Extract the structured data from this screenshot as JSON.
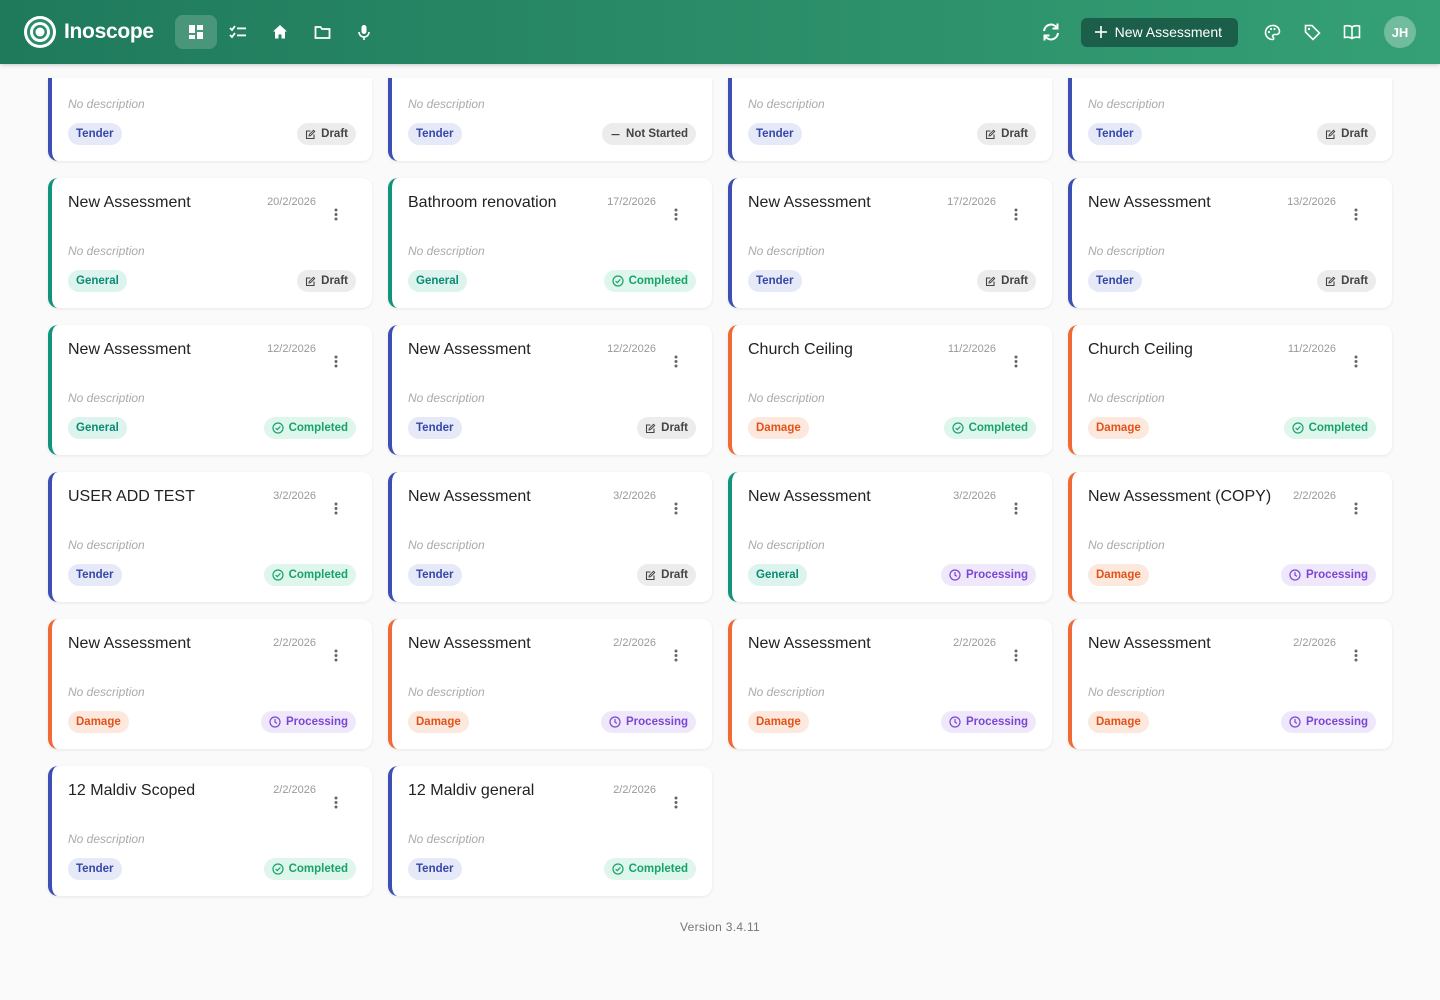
{
  "app": {
    "name": "Inoscope",
    "new_button_label": "New Assessment",
    "avatar_initials": "JH"
  },
  "nav": [
    {
      "icon": "dashboard-icon",
      "active": true
    },
    {
      "icon": "checklist-icon",
      "active": false
    },
    {
      "icon": "home-icon",
      "active": false
    },
    {
      "icon": "folder-icon",
      "active": false
    },
    {
      "icon": "microphone-icon",
      "active": false
    }
  ],
  "colors": {
    "tender": "#3d4fb4",
    "general": "#11937c",
    "damage": "#f06a35",
    "header": "#2a8c68"
  },
  "cards": [
    {
      "title": "",
      "date": "",
      "description": "No description",
      "type": "Tender",
      "status": "Draft"
    },
    {
      "title": "",
      "date": "",
      "description": "No description",
      "type": "Tender",
      "status": "Not Started"
    },
    {
      "title": "",
      "date": "",
      "description": "No description",
      "type": "Tender",
      "status": "Draft"
    },
    {
      "title": "",
      "date": "",
      "description": "No description",
      "type": "Tender",
      "status": "Draft"
    },
    {
      "title": "New Assessment",
      "date": "20/2/2026",
      "description": "No description",
      "type": "General",
      "status": "Draft"
    },
    {
      "title": "Bathroom renovation",
      "date": "17/2/2026",
      "description": "No description",
      "type": "General",
      "status": "Completed"
    },
    {
      "title": "New Assessment",
      "date": "17/2/2026",
      "description": "No description",
      "type": "Tender",
      "status": "Draft"
    },
    {
      "title": "New Assessment",
      "date": "13/2/2026",
      "description": "No description",
      "type": "Tender",
      "status": "Draft"
    },
    {
      "title": "New Assessment",
      "date": "12/2/2026",
      "description": "No description",
      "type": "General",
      "status": "Completed"
    },
    {
      "title": "New Assessment",
      "date": "12/2/2026",
      "description": "No description",
      "type": "Tender",
      "status": "Draft"
    },
    {
      "title": "Church Ceiling",
      "date": "11/2/2026",
      "description": "No description",
      "type": "Damage",
      "status": "Completed"
    },
    {
      "title": "Church Ceiling",
      "date": "11/2/2026",
      "description": "No description",
      "type": "Damage",
      "status": "Completed"
    },
    {
      "title": "USER ADD TEST",
      "date": "3/2/2026",
      "description": "No description",
      "type": "Tender",
      "status": "Completed"
    },
    {
      "title": "New Assessment",
      "date": "3/2/2026",
      "description": "No description",
      "type": "Tender",
      "status": "Draft"
    },
    {
      "title": "New Assessment",
      "date": "3/2/2026",
      "description": "No description",
      "type": "General",
      "status": "Processing"
    },
    {
      "title": "New Assessment (COPY)",
      "date": "2/2/2026",
      "description": "No description",
      "type": "Damage",
      "status": "Processing"
    },
    {
      "title": "New Assessment",
      "date": "2/2/2026",
      "description": "No description",
      "type": "Damage",
      "status": "Processing"
    },
    {
      "title": "New Assessment",
      "date": "2/2/2026",
      "description": "No description",
      "type": "Damage",
      "status": "Processing"
    },
    {
      "title": "New Assessment",
      "date": "2/2/2026",
      "description": "No description",
      "type": "Damage",
      "status": "Processing"
    },
    {
      "title": "New Assessment",
      "date": "2/2/2026",
      "description": "No description",
      "type": "Damage",
      "status": "Processing"
    },
    {
      "title": "12 Maldiv Scoped",
      "date": "2/2/2026",
      "description": "No description",
      "type": "Tender",
      "status": "Completed"
    },
    {
      "title": "12 Maldiv general",
      "date": "2/2/2026",
      "description": "No description",
      "type": "Tender",
      "status": "Completed"
    }
  ],
  "footer": {
    "version": "Version 3.4.11"
  }
}
